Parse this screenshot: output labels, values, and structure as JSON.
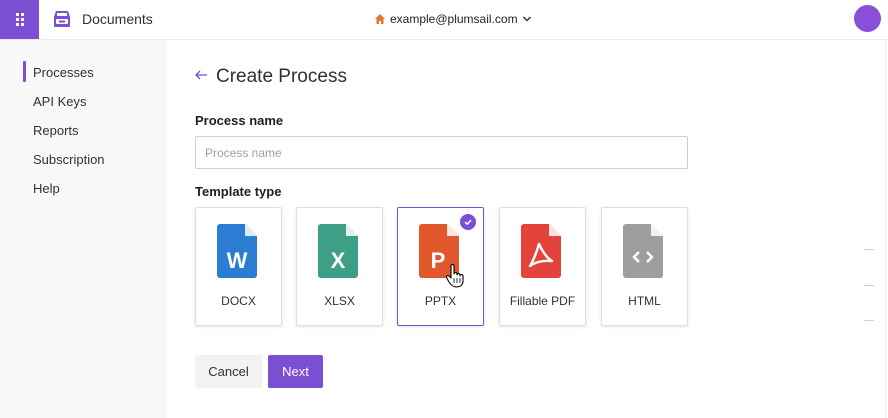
{
  "app": {
    "title": "Documents",
    "account_email": "example@plumsail.com"
  },
  "icons": {
    "launcher": "app-launcher-grid-icon",
    "brand": "documents-tray-icon",
    "home": "home-icon",
    "account_chevron": "chevron-down-icon",
    "back": "back-arrow-icon",
    "check": "checkmark-icon"
  },
  "colors": {
    "accent": "#7a4fd1",
    "docx": "#2b7cd3",
    "xlsx": "#3f9f86",
    "pptx": "#e0582c",
    "pdf": "#e4433b",
    "html": "#9e9e9e"
  },
  "sidebar": {
    "items": [
      {
        "label": "Processes",
        "active": true
      },
      {
        "label": "API Keys",
        "active": false
      },
      {
        "label": "Reports",
        "active": false
      },
      {
        "label": "Subscription",
        "active": false
      },
      {
        "label": "Help",
        "active": false
      }
    ]
  },
  "main": {
    "title": "Create Process",
    "process_name_label": "Process name",
    "process_name_placeholder": "Process name",
    "process_name_value": "",
    "template_type_label": "Template type",
    "templates": [
      {
        "label": "DOCX",
        "glyph": "W",
        "selected": false
      },
      {
        "label": "XLSX",
        "glyph": "X",
        "selected": false
      },
      {
        "label": "PPTX",
        "glyph": "P",
        "selected": true
      },
      {
        "label": "Fillable PDF",
        "glyph": "pdf",
        "selected": false
      },
      {
        "label": "HTML",
        "glyph": "<>",
        "selected": false
      }
    ],
    "cancel_label": "Cancel",
    "next_label": "Next"
  }
}
